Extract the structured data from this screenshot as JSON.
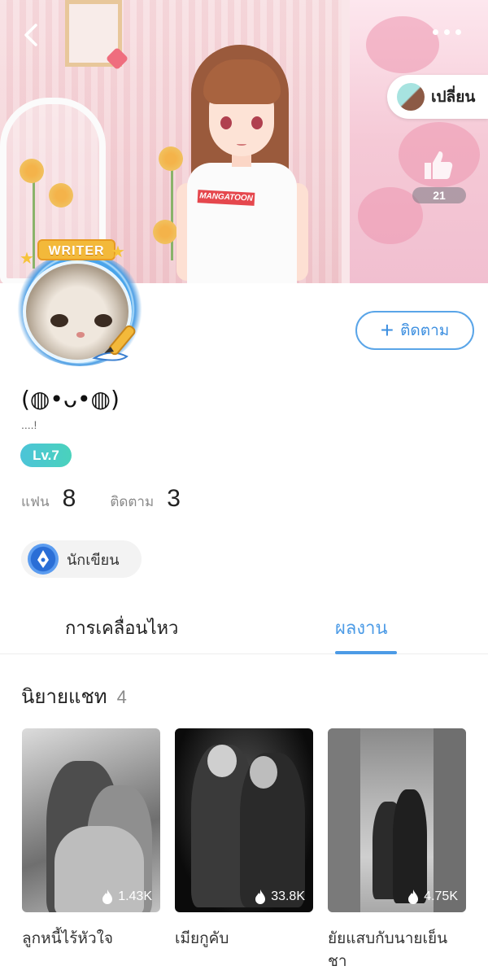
{
  "hero": {
    "shirt_logo": "MANGATOON",
    "switch_label": "เปลี่ยน",
    "like_count": "21"
  },
  "avatar": {
    "banner": "WRITER"
  },
  "follow_button": {
    "plus": "+",
    "label": "ติดตาม"
  },
  "profile": {
    "username": "(◍•ᴗ•◍)",
    "bio": "....!",
    "level": "Lv.7"
  },
  "stats": {
    "fans_label": "แฟน",
    "fans_value": "8",
    "following_label": "ติดตาม",
    "following_value": "3"
  },
  "badge": {
    "label": "นักเขียน"
  },
  "tabs": [
    {
      "label": "การเคลื่อนไหว",
      "active": false
    },
    {
      "label": "ผลงาน",
      "active": true
    }
  ],
  "section": {
    "label": "นิยายแชท",
    "count": "4"
  },
  "works": [
    {
      "title": "ลูกหนี้ไร้หัวใจ",
      "views": "1.43K",
      "icon": "fire-icon"
    },
    {
      "title": "เมียกูคับ",
      "views": "33.8K",
      "icon": "fire-icon"
    },
    {
      "title": "ยัยแสบกับนายเย็นชา",
      "views": "4.75K",
      "icon": "fire-icon"
    }
  ],
  "colors": {
    "accent": "#4c9be6",
    "level_gradient_start": "#4cc4d8",
    "level_gradient_end": "#4ad2bc"
  }
}
